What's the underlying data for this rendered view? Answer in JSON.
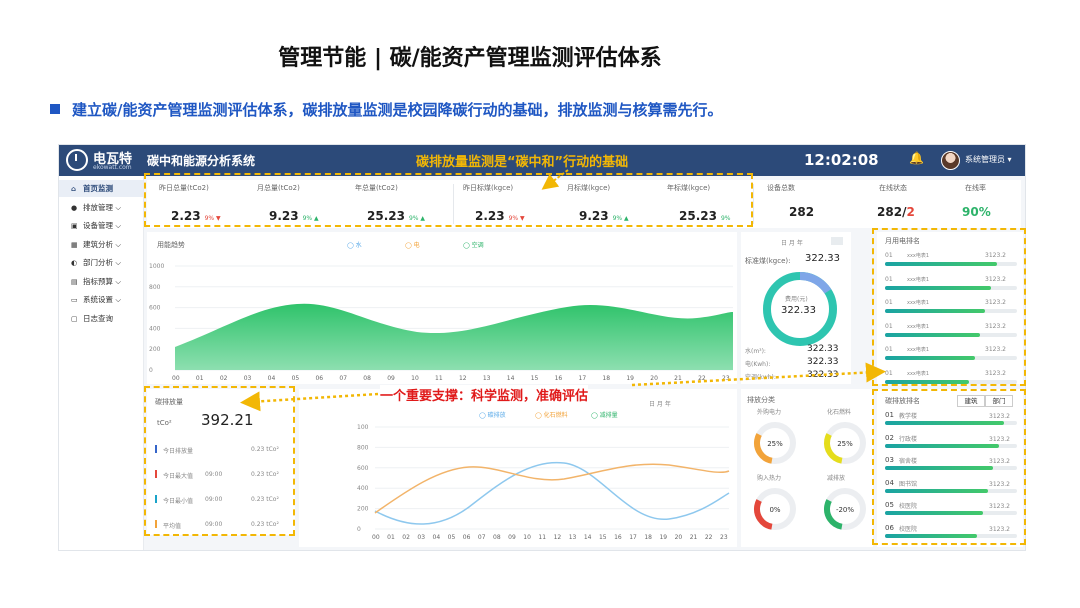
{
  "slide": {
    "title": "管理节能 | 碳/能资产管理监测评估体系",
    "bullet": "建立碳/能资产管理监测评估体系，碳排放量监测是校园降碳行动的基础，排放监测与核算需先行。"
  },
  "callouts": {
    "top": "碳排放量监测是“碳中和”行动的基础",
    "middle": "一个重要支撑：科学监测，准确评估"
  },
  "app": {
    "logo_name": "电瓦特",
    "logo_sub": "ekowatt.com",
    "system_title": "碳中和能源分析系统",
    "clock": "12:02:08",
    "user": "系统管理员 ▾",
    "colors": {
      "topbar": "#2c4a79",
      "highlight": "#f2b705",
      "red": "#e01a1a"
    }
  },
  "sidebar": {
    "items": [
      {
        "label": "首页监测",
        "icon": "home-icon",
        "glyph": "⌂"
      },
      {
        "label": "排放管理 ⌵",
        "icon": "emission-icon",
        "glyph": "●"
      },
      {
        "label": "设备管理 ⌵",
        "icon": "device-icon",
        "glyph": "▣"
      },
      {
        "label": "建筑分析 ⌵",
        "icon": "building-icon",
        "glyph": "▦"
      },
      {
        "label": "部门分析 ⌵",
        "icon": "dept-icon",
        "glyph": "◐"
      },
      {
        "label": "指标预算 ⌵",
        "icon": "budget-icon",
        "glyph": "▤"
      },
      {
        "label": "系统设置 ⌵",
        "icon": "settings-icon",
        "glyph": "▭"
      },
      {
        "label": "日志查询",
        "icon": "log-icon",
        "glyph": "▢"
      }
    ]
  },
  "kpis": [
    {
      "label": "昨日总量(tCo2)",
      "value": "2.23",
      "pct": "9%",
      "arrow": "▼",
      "tone": "r"
    },
    {
      "label": "月总量(tCo2)",
      "value": "9.23",
      "pct": "9%",
      "arrow": "▲",
      "tone": "g"
    },
    {
      "label": "年总量(tCo2)",
      "value": "25.23",
      "pct": "9%",
      "arrow": "▲",
      "tone": "g"
    },
    {
      "label": "昨日标煤(kgce)",
      "value": "2.23",
      "pct": "9%",
      "arrow": "▼",
      "tone": "r"
    },
    {
      "label": "月标煤(kgce)",
      "value": "9.23",
      "pct": "9%",
      "arrow": "▲",
      "tone": "g"
    },
    {
      "label": "年标煤(kgce)",
      "value": "25.23",
      "pct": "9%",
      "arrow": "",
      "tone": "g"
    }
  ],
  "device_stats": {
    "total_label": "设备总数",
    "total": "282",
    "online_label": "在线状态",
    "online": "282",
    "offline": "2",
    "rate_label": "在线率",
    "rate": "90%"
  },
  "energy_chart": {
    "title": "用能趋势",
    "legend": [
      "水",
      "电",
      "空调"
    ],
    "yticks": [
      "1000",
      "800",
      "600",
      "400",
      "200",
      "0"
    ],
    "xticks": [
      "00",
      "01",
      "02",
      "03",
      "04",
      "05",
      "06",
      "07",
      "08",
      "09",
      "10",
      "11",
      "12",
      "13",
      "14",
      "15",
      "16",
      "17",
      "18",
      "19",
      "20",
      "21",
      "22",
      "23"
    ]
  },
  "coal_panel": {
    "tabs": "日  月  年",
    "std_label": "标准煤(kgce):",
    "std_value": "322.33",
    "donut_label": "费用(元)",
    "donut_value": "322.33",
    "donut_fraction": 0.16,
    "rows": [
      {
        "label": "水(m³):",
        "value": "322.33"
      },
      {
        "label": "电(Kwh):",
        "value": "322.33"
      },
      {
        "label": "空调(kwh):",
        "value": "322.33"
      }
    ]
  },
  "power_rank": {
    "title": "月用电排名",
    "rows": [
      {
        "no": "01",
        "name": "xxx电表1",
        "value": "3123.2",
        "fill": 0.85
      },
      {
        "no": "01",
        "name": "xxx电表1",
        "value": "3123.2",
        "fill": 0.8
      },
      {
        "no": "01",
        "name": "xxx电表1",
        "value": "3123.2",
        "fill": 0.76
      },
      {
        "no": "01",
        "name": "xxx电表1",
        "value": "3123.2",
        "fill": 0.72
      },
      {
        "no": "01",
        "name": "xxx电表1",
        "value": "3123.2",
        "fill": 0.68
      },
      {
        "no": "01",
        "name": "xxx电表1",
        "value": "3123.2",
        "fill": 0.64
      }
    ]
  },
  "carbon_panel": {
    "title": "碳排放量",
    "unit": "tCo²",
    "value": "392.21",
    "rows": [
      {
        "label": "今日排放量",
        "time": "",
        "value": "0.23",
        "unit": "tCo²",
        "color": "#3565c9"
      },
      {
        "label": "今日最大值",
        "time": "09:00",
        "value": "0.23",
        "unit": "tCo²",
        "color": "#e4473b"
      },
      {
        "label": "今日最小值",
        "time": "09:00",
        "value": "0.23",
        "unit": "tCo²",
        "color": "#1aa3c9"
      },
      {
        "label": "平均值",
        "time": "09:00",
        "value": "0.23",
        "unit": "tCo²",
        "color": "#f2a33a"
      }
    ]
  },
  "carbon_chart": {
    "legend": [
      "碳排放",
      "化石燃料",
      "减排量"
    ],
    "tabs": "日  月  年",
    "yticks": [
      "100",
      "800",
      "600",
      "400",
      "200",
      "0"
    ],
    "xticks": [
      "00",
      "01",
      "02",
      "03",
      "04",
      "05",
      "06",
      "07",
      "08",
      "09",
      "10",
      "11",
      "12",
      "13",
      "14",
      "15",
      "16",
      "17",
      "18",
      "19",
      "20",
      "21",
      "22",
      "23"
    ]
  },
  "emission_class": {
    "title": "排放分类",
    "items": [
      {
        "label": "外购电力",
        "pct": "25%",
        "fraction": 0.25,
        "color": "#f2a33a"
      },
      {
        "label": "化石燃料",
        "pct": "25%",
        "fraction": 0.25,
        "color": "#e5dd1c"
      },
      {
        "label": "购入热力",
        "pct": "0%",
        "fraction": 0.0,
        "color": "#e4473b"
      },
      {
        "label": "减排放",
        "pct": "-20%",
        "fraction": 0.2,
        "color": "#2db36a"
      }
    ]
  },
  "emission_rank": {
    "title": "碳排放排名",
    "tabs": [
      "建筑",
      "部门"
    ],
    "rows": [
      {
        "no": "01",
        "name": "教学楼",
        "value": "3123.2",
        "fill": 0.9
      },
      {
        "no": "02",
        "name": "行政楼",
        "value": "3123.2",
        "fill": 0.86
      },
      {
        "no": "03",
        "name": "宿舍楼",
        "value": "3123.2",
        "fill": 0.82
      },
      {
        "no": "04",
        "name": "图书馆",
        "value": "3123.2",
        "fill": 0.78
      },
      {
        "no": "05",
        "name": "校医院",
        "value": "3123.2",
        "fill": 0.74
      },
      {
        "no": "06",
        "name": "校医院",
        "value": "3123.2",
        "fill": 0.7
      }
    ]
  }
}
